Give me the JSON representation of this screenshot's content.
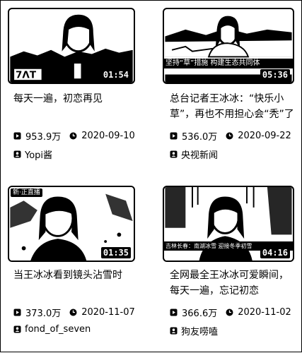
{
  "videos": [
    {
      "title": "每天一遍，初恋再见",
      "views": "953.9万",
      "date": "2020-09-10",
      "author": "Yopi酱",
      "duration": "01:54",
      "overlay": "",
      "tag": "",
      "subtitle": ""
    },
    {
      "title": "总台记者王冰冰：“快乐小草”，再也不用担心会“秃”了",
      "views": "536.0万",
      "date": "2020-09-22",
      "author": "央视新闻",
      "duration": "05:36",
      "overlay": "坚持“草”措施 构建生态共同体",
      "tag": "",
      "subtitle": ""
    },
    {
      "title": "当王冰冰看到镜头沾雪时",
      "views": "373.0万",
      "date": "2020-11-07",
      "author": "fond_of_seven",
      "duration": "01:35",
      "overlay": "",
      "tag": "新·正直播",
      "subtitle": ""
    },
    {
      "title": "全网最全王冰冰可爱瞬间，每天一遍，忘记初恋",
      "views": "366.6万",
      "date": "2020-11-02",
      "author": "狗友唠嗑",
      "duration": "04:16",
      "overlay": "",
      "tag": "",
      "subtitle": "吉林长春：南湖冰雪 迎接冬季初雪"
    }
  ],
  "icons": {
    "views": "play-count-icon",
    "date": "clock-icon",
    "author": "uploader-icon"
  }
}
